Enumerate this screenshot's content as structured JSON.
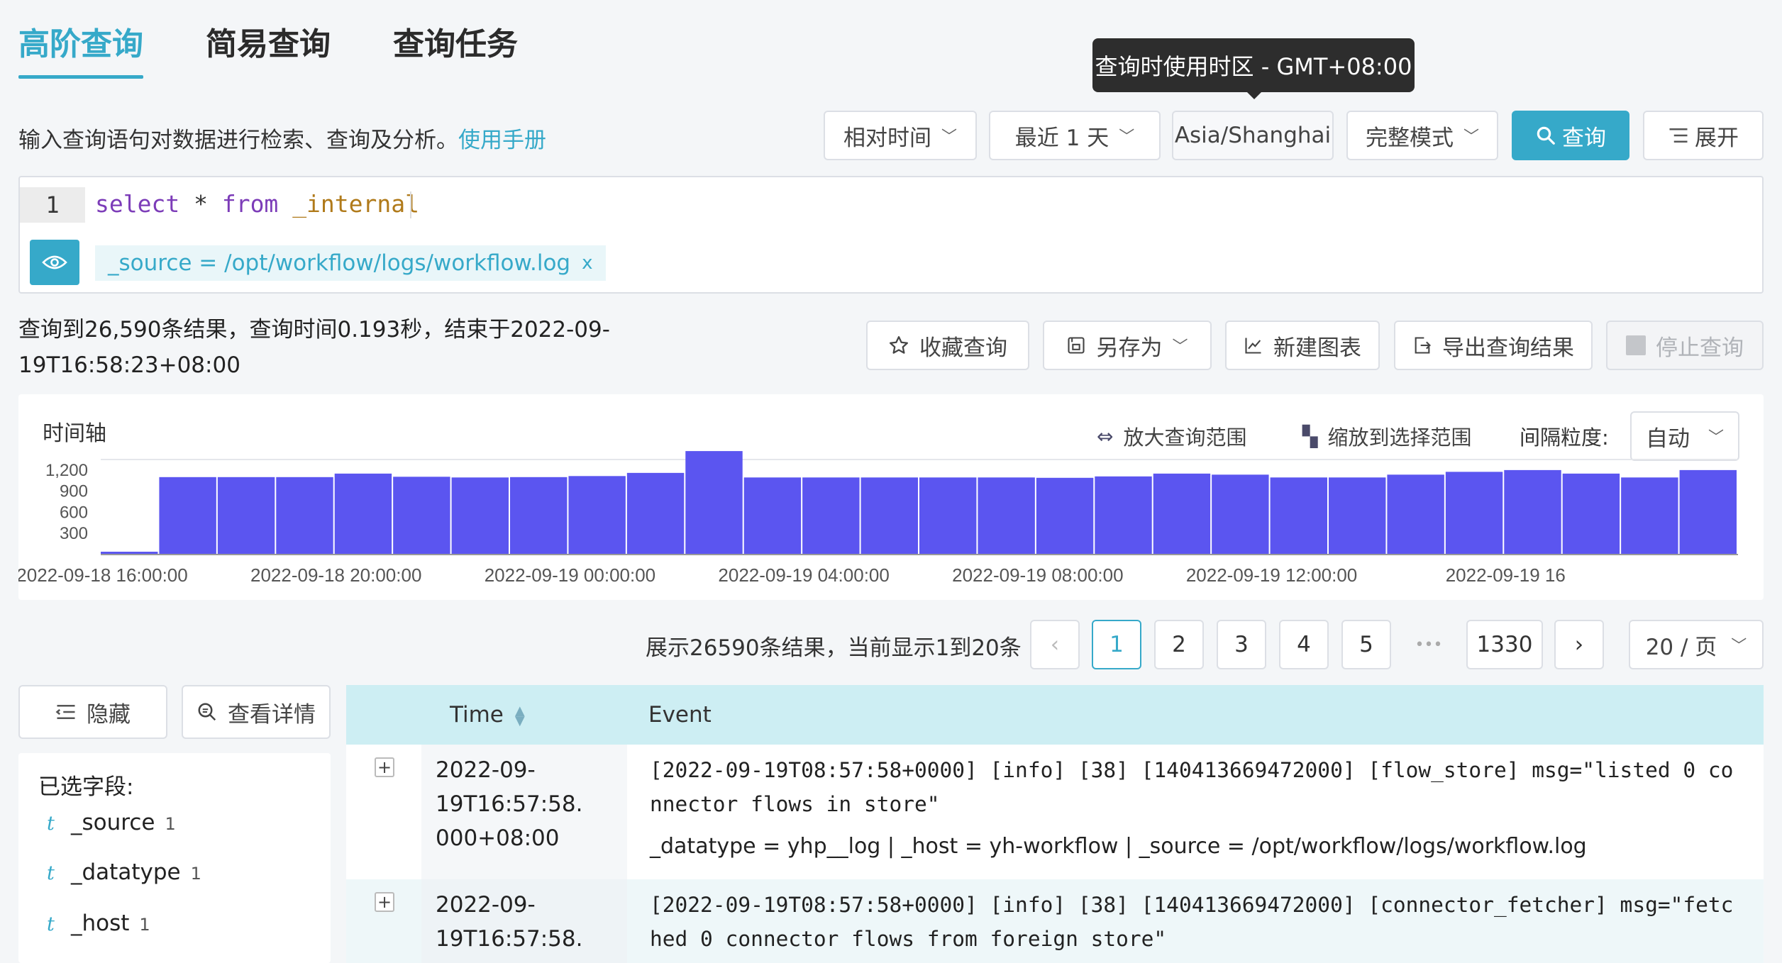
{
  "tabs": [
    {
      "label": "高阶查询",
      "active": true
    },
    {
      "label": "简易查询",
      "active": false
    },
    {
      "label": "查询任务",
      "active": false
    }
  ],
  "tooltip": "查询时使用时区 - GMT+08:00",
  "description": {
    "text": "输入查询语句对数据进行检索、查询及分析。",
    "link": "使用手册"
  },
  "toolbar": {
    "time_mode": "相对时间",
    "time_range": "最近 1 天",
    "timezone": "Asia/Shanghai",
    "mode": "完整模式",
    "query": "查询",
    "expand": "展开"
  },
  "editor": {
    "line_number": "1",
    "tokens": {
      "kw1": "select",
      "op": " * ",
      "kw2": "from",
      "sp": " ",
      "table": "_internal"
    },
    "filter": "_source = /opt/workflow/logs/workflow.log",
    "filter_close": "x"
  },
  "result": {
    "summary": "查询到26,590条结果，查询时间0.193秒，结束于2022-09-19T16:58:23+08:00"
  },
  "actions": {
    "favorite": "收藏查询",
    "save_as": "另存为",
    "new_chart": "新建图表",
    "export": "导出查询结果",
    "stop": "停止查询"
  },
  "timeline": {
    "title": "时间轴",
    "zoom_out": "放大查询范围",
    "zoom_in": "缩放到选择范围",
    "interval_label": "间隔粒度:",
    "interval_value": "自动"
  },
  "chart_data": {
    "type": "bar",
    "ylim": [
      0,
      1350
    ],
    "yticks": [
      "1,200",
      "900",
      "600",
      "300"
    ],
    "xticks": [
      "2022-09-18 16:00:00",
      "2022-09-18 20:00:00",
      "2022-09-19 00:00:00",
      "2022-09-19 04:00:00",
      "2022-09-19 08:00:00",
      "2022-09-19 12:00:00",
      "2022-09-19 16"
    ],
    "values": [
      40,
      1100,
      1100,
      1100,
      1150,
      1105,
      1095,
      1100,
      1115,
      1160,
      1470,
      1095,
      1095,
      1095,
      1095,
      1095,
      1090,
      1110,
      1150,
      1135,
      1095,
      1095,
      1135,
      1175,
      1200,
      1150,
      1095,
      1200
    ],
    "color": "#5b55f0"
  },
  "pagination": {
    "info": "展示26590条结果，当前显示1到20条",
    "pages": [
      "1",
      "2",
      "3",
      "4",
      "5"
    ],
    "ellipsis": "•••",
    "last": "1330",
    "prev": "‹",
    "next": "›",
    "page_size": "20 / 页"
  },
  "side": {
    "hide": "隐藏",
    "details": "查看详情",
    "selected_title": "已选字段:",
    "fields": [
      {
        "type": "t",
        "name": "_source",
        "count": "1"
      },
      {
        "type": "t",
        "name": "_datatype",
        "count": "1"
      },
      {
        "type": "t",
        "name": "_host",
        "count": "1"
      }
    ]
  },
  "table": {
    "headers": {
      "time": "Time",
      "event": "Event"
    },
    "rows": [
      {
        "expand": "+",
        "time_lines": [
          "2022-09-",
          "19T16:57:58.",
          "000+08:00"
        ],
        "log": "[2022-09-19T08:57:58+0000] [info] [38] [140413669472000] [flow_store] msg=\"listed 0 connector flows in store\"",
        "meta": "_datatype = yhp__log | _host = yh-workflow | _source = /opt/workflow/logs/workflow.log"
      },
      {
        "expand": "+",
        "time_lines": [
          "2022-09-",
          "19T16:57:58."
        ],
        "log": "[2022-09-19T08:57:58+0000] [info] [38] [140413669472000] [connector_fetcher] msg=\"fetched 0 connector flows from foreign store\""
      }
    ]
  }
}
